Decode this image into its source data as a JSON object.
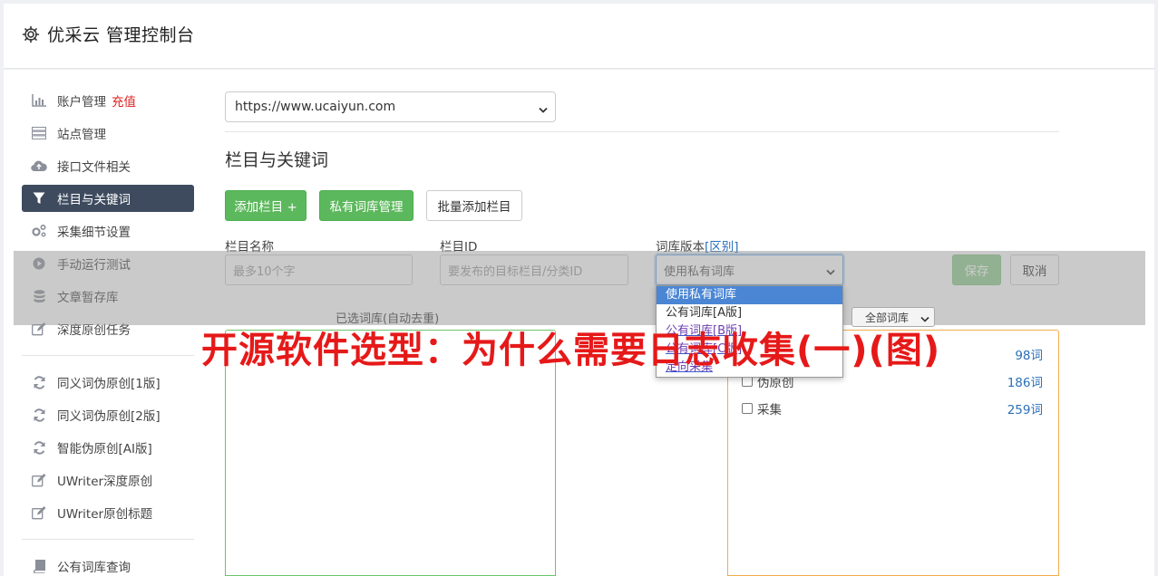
{
  "header": {
    "title": "优采云 管理控制台",
    "icon": "gear-icon"
  },
  "sidebar": {
    "groups": [
      [
        {
          "label": "账户管理",
          "badge": "充值",
          "icon": "bar-chart-icon"
        },
        {
          "label": "站点管理",
          "icon": "server-icon"
        },
        {
          "label": "接口文件相关",
          "icon": "cloud-upload-icon"
        },
        {
          "label": "栏目与关键词",
          "icon": "filter-icon",
          "active": true
        },
        {
          "label": "采集细节设置",
          "icon": "gears-icon"
        },
        {
          "label": "手动运行测试",
          "icon": "play-circle-icon"
        },
        {
          "label": "文章暂存库",
          "icon": "database-icon"
        },
        {
          "label": "深度原创任务",
          "icon": "edit-icon"
        }
      ],
      [
        {
          "label": "同义词伪原创[1版]",
          "icon": "refresh-icon"
        },
        {
          "label": "同义词伪原创[2版]",
          "icon": "refresh-icon"
        },
        {
          "label": "智能伪原创[AI版]",
          "icon": "refresh-icon"
        },
        {
          "label": "UWriter深度原创",
          "icon": "edit-icon"
        },
        {
          "label": "UWriter原创标题",
          "icon": "edit-icon"
        }
      ],
      [
        {
          "label": "公有词库查询",
          "icon": "book-icon"
        }
      ]
    ]
  },
  "content": {
    "site_select": "https://www.ucaiyun.com",
    "section_title": "栏目与关键词",
    "buttons": {
      "add_column": "添加栏目 +",
      "private_lib": "私有词库管理",
      "batch_add": "批量添加栏目",
      "save": "保存",
      "cancel": "取消"
    },
    "fields": {
      "column_name_label": "栏目名称",
      "column_name_placeholder": "最多10个字",
      "column_id_label": "栏目ID",
      "column_id_placeholder": "要发布的目标栏目/分类ID",
      "lib_version_label": "词库版本",
      "lib_version_link": "[区别]",
      "lib_version_value": "使用私有词库"
    },
    "dropdown_options": [
      "使用私有词库",
      "公有词库[A版]",
      "公有词库[B版]",
      "公有词库[C版]",
      "定向采集"
    ],
    "selected_caption": "已选词库(自动去重)",
    "filter_select": "全部词库",
    "library_rows": [
      {
        "label": "",
        "count": "98词"
      },
      {
        "label": "伪原创",
        "count": "186词"
      },
      {
        "label": "采集",
        "count": "259词"
      }
    ],
    "watermark": "开源软件选型：为什么需要日志收集(一)(图)"
  },
  "colors": {
    "sidebar_active": "#3e4b5f",
    "primary_green": "#5cb85c",
    "link_blue": "#2a6fb8",
    "badge_red": "#e02020",
    "watermark_red": "#e61919"
  }
}
